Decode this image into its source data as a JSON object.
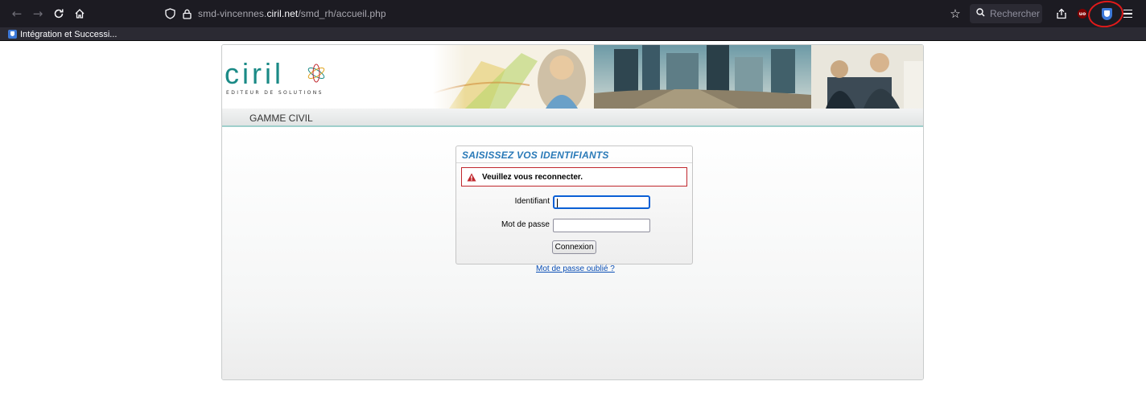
{
  "browser": {
    "url_prefix": "smd-vincennes.",
    "url_domain": "ciril.net",
    "url_path": "/smd_rh/accueil.php",
    "search_placeholder": "Rechercher",
    "bookmark_label": "Intégration et Successi...",
    "icons": {
      "back": "arrow-left-icon",
      "forward": "arrow-right-icon",
      "reload": "reload-icon",
      "home": "home-icon",
      "tracking": "shield-icon",
      "lock": "lock-icon",
      "bookmark_star": "star-icon",
      "search": "search-icon",
      "share": "share-icon",
      "ublock": "ublock-icon",
      "bitwarden": "bitwarden-icon",
      "menu": "hamburger-menu-icon"
    },
    "annotation_color": "#e11a1a"
  },
  "site": {
    "logo_text": "ciril",
    "logo_tagline": "EDITEUR DE SOLUTIONS",
    "tab_label": "GAMME CIVIL",
    "accent_color": "#1a8a86"
  },
  "login": {
    "title": "SAISISSEZ VOS IDENTIFIANTS",
    "alert": "Veuillez vous reconnecter.",
    "identifiant_label": "Identifiant",
    "identifiant_value": "",
    "password_label": "Mot de passe",
    "password_value": "",
    "submit_label": "Connexion",
    "forgot_link": "Mot de passe oublié ?",
    "title_color": "#2a7ab8",
    "alert_color": "#c0272d"
  }
}
